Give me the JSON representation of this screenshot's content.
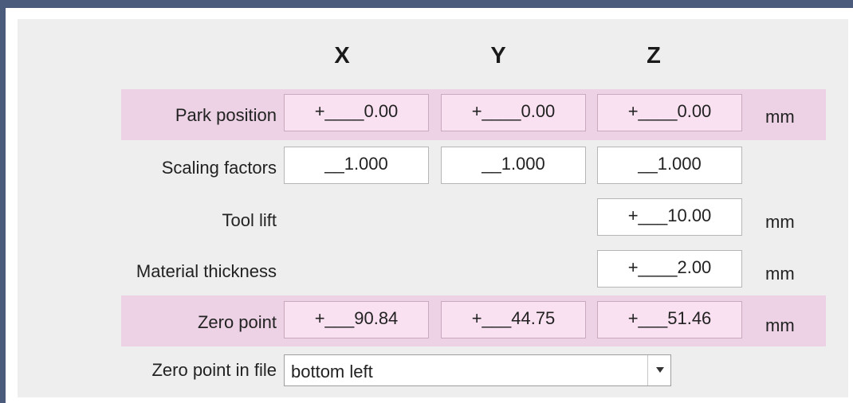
{
  "columns": {
    "x": "X",
    "y": "Y",
    "z": "Z"
  },
  "rows": {
    "park_position": {
      "label": "Park position",
      "x": "+____0.00",
      "y": "+____0.00",
      "z": "+____0.00",
      "unit": "mm"
    },
    "scaling_factors": {
      "label": "Scaling factors",
      "x": "__1.000",
      "y": "__1.000",
      "z": "__1.000"
    },
    "tool_lift": {
      "label": "Tool lift",
      "z": "+___10.00",
      "unit": "mm"
    },
    "material_thickness": {
      "label": "Material thickness",
      "z": "+____2.00",
      "unit": "mm"
    },
    "zero_point": {
      "label": "Zero point",
      "x": "+___90.84",
      "y": "+___44.75",
      "z": "+___51.46",
      "unit": "mm"
    },
    "zero_point_in_file": {
      "label": "Zero point in file",
      "value": "bottom left"
    }
  },
  "colors": {
    "highlight_row": "#ecd2e4",
    "highlight_field": "#fae1f1",
    "frame": "#4a5b7c"
  },
  "icons": {
    "dropdown": "chevron-down-icon"
  }
}
